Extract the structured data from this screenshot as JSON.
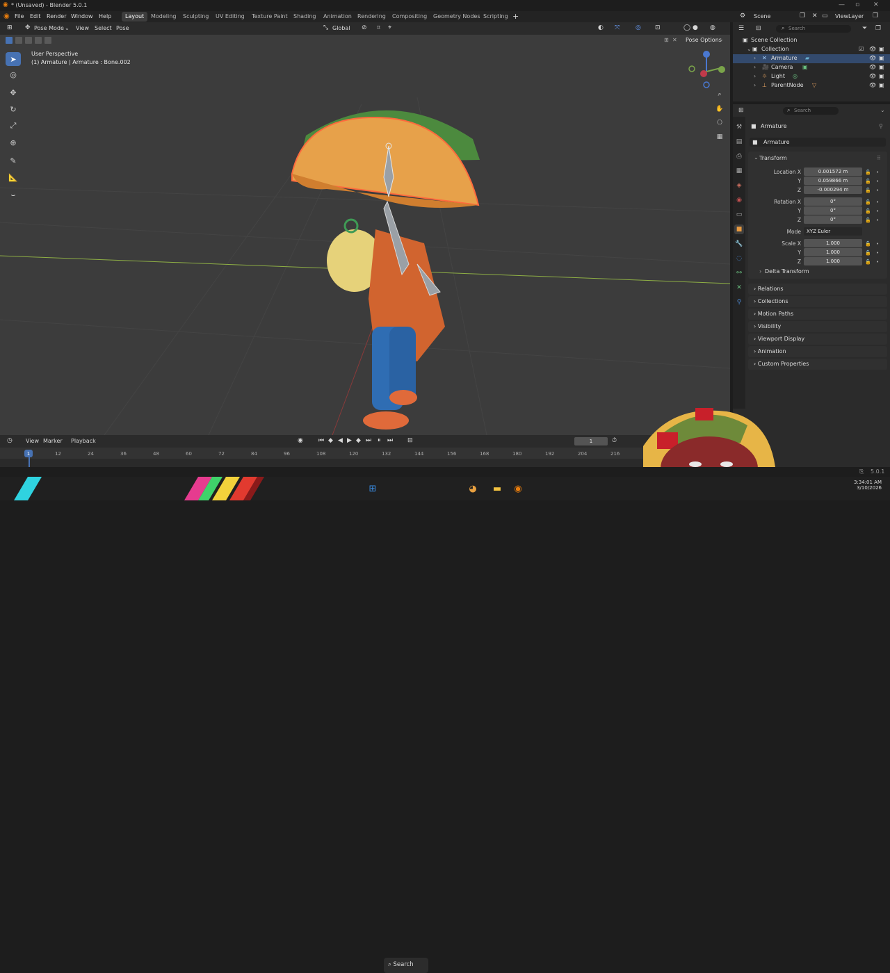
{
  "window": {
    "title": "* (Unsaved) - Blender 5.0.1"
  },
  "menu": [
    "File",
    "Edit",
    "Render",
    "Window",
    "Help"
  ],
  "workspaces": [
    "Layout",
    "Modeling",
    "Sculpting",
    "UV Editing",
    "Texture Paint",
    "Shading",
    "Animation",
    "Rendering",
    "Compositing",
    "Geometry Nodes",
    "Scripting"
  ],
  "active_workspace": "Layout",
  "scene": {
    "scene_name": "Scene",
    "view_layer": "ViewLayer"
  },
  "viewport_header": {
    "mode": "Pose Mode",
    "menus": [
      "View",
      "Select",
      "Pose"
    ],
    "orientation": "Global",
    "pose_options": "Pose Options"
  },
  "viewport": {
    "perspective": "User Perspective",
    "context": "(1) Armature | Armature : Bone.002"
  },
  "outliner": {
    "search_placeholder": "Search",
    "root": "Scene Collection",
    "collection": "Collection",
    "items": [
      "Armature",
      "Camera",
      "Light",
      "ParentNode"
    ]
  },
  "properties": {
    "search_placeholder": "Search",
    "object_name": "Armature",
    "data_name": "Armature",
    "transform_title": "Transform",
    "location_label": "Location X",
    "location": [
      "0.001572 m",
      "0.059866 m",
      "-0.000294 m"
    ],
    "rotation_label": "Rotation X",
    "rotation": [
      "0°",
      "0°",
      "0°"
    ],
    "mode_label": "Mode",
    "mode_value": "XYZ Euler",
    "scale_label": "Scale X",
    "scale": [
      "1.000",
      "1.000",
      "1.000"
    ],
    "axis_y": "Y",
    "axis_z": "Z",
    "delta_transform": "Delta Transform",
    "panels": [
      "Relations",
      "Collections",
      "Motion Paths",
      "Visibility",
      "Viewport Display",
      "Animation",
      "Custom Properties"
    ]
  },
  "timeline": {
    "menus": [
      "View",
      "Marker",
      "Playback"
    ],
    "current_frame": "1",
    "end_frame_visible": "0",
    "ticks": [
      "12",
      "24",
      "36",
      "48",
      "60",
      "72",
      "84",
      "96",
      "108",
      "120",
      "132",
      "144",
      "156",
      "168",
      "180",
      "192",
      "204",
      "216"
    ],
    "playhead": "1"
  },
  "status": {
    "version": "5.0.1"
  },
  "taskbar": {
    "search_label": "Search",
    "time": "3:34:01 AM",
    "date": "3/10/2026"
  },
  "colors": {
    "accent": "#4772b3",
    "selection": "#334a6d",
    "x_axis": "#b0d36f",
    "viewport_bg": "#3c3c3c"
  }
}
